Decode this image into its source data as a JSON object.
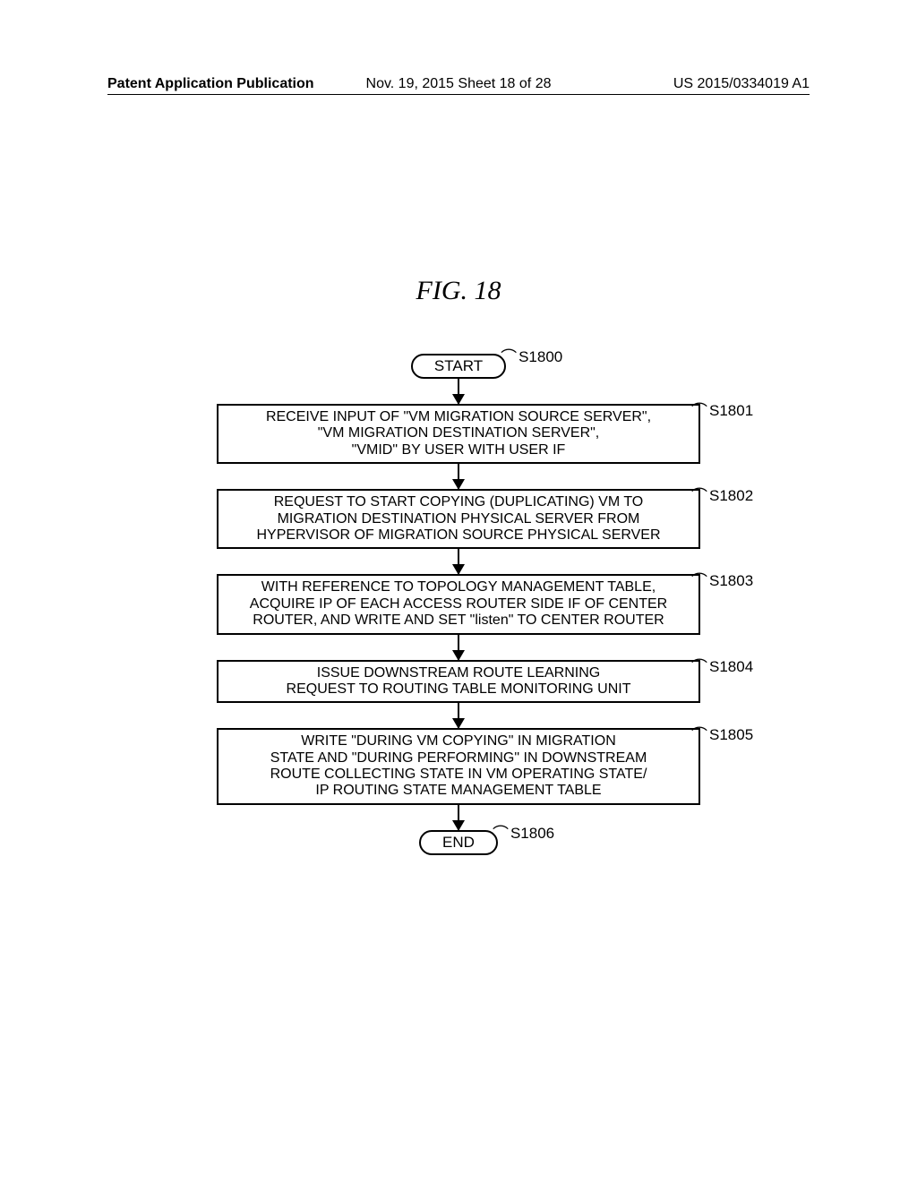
{
  "header": {
    "left": "Patent Application Publication",
    "center": "Nov. 19, 2015  Sheet 18 of 28",
    "right": "US 2015/0334019 A1"
  },
  "figure_title": "FIG. 18",
  "flow": {
    "start": {
      "label": "START",
      "step": "S1800"
    },
    "steps": [
      {
        "step": "S1801",
        "text": "RECEIVE INPUT OF \"VM MIGRATION SOURCE SERVER\",\n\"VM MIGRATION DESTINATION SERVER\",\n\"VMID\" BY USER WITH USER IF"
      },
      {
        "step": "S1802",
        "text": "REQUEST TO START COPYING (DUPLICATING) VM TO\nMIGRATION DESTINATION PHYSICAL SERVER FROM\nHYPERVISOR OF MIGRATION SOURCE PHYSICAL SERVER"
      },
      {
        "step": "S1803",
        "text": "WITH REFERENCE TO TOPOLOGY MANAGEMENT TABLE,\nACQUIRE IP OF EACH ACCESS ROUTER SIDE IF OF CENTER\nROUTER, AND WRITE AND SET \"listen\" TO CENTER ROUTER"
      },
      {
        "step": "S1804",
        "text": "ISSUE DOWNSTREAM ROUTE LEARNING\nREQUEST TO ROUTING TABLE MONITORING UNIT"
      },
      {
        "step": "S1805",
        "text": "WRITE \"DURING VM COPYING\" IN MIGRATION\nSTATE AND \"DURING PERFORMING\" IN DOWNSTREAM\nROUTE COLLECTING STATE IN VM OPERATING STATE/\nIP ROUTING STATE MANAGEMENT TABLE"
      }
    ],
    "end": {
      "label": "END",
      "step": "S1806"
    }
  }
}
